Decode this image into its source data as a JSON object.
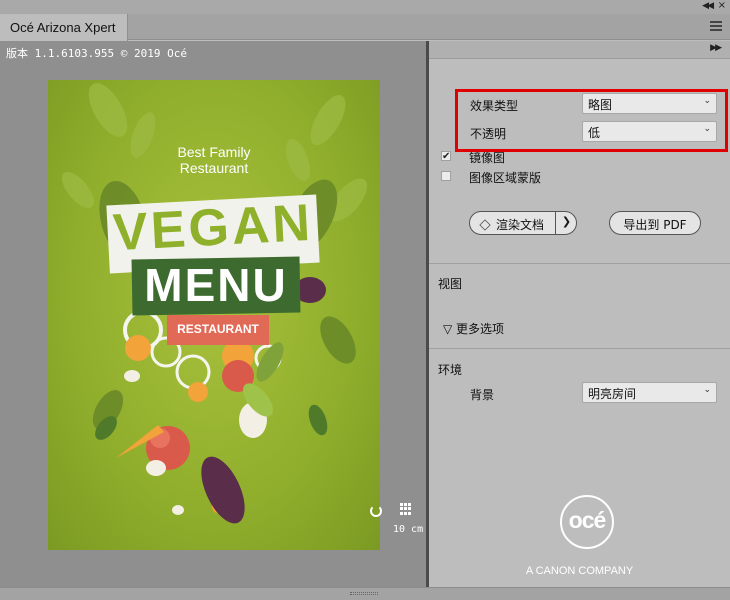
{
  "window": {
    "tab_title": "Océ Arizona Xpert"
  },
  "preview": {
    "version_text": "版本 1.1.6103.955 © 2019 Océ",
    "poster": {
      "line1": "Best Family",
      "line2": "Restaurant",
      "title1": "VEGAN",
      "title2": "MENU",
      "subtitle": "RESTAURANT"
    },
    "scale_text": "10 cm"
  },
  "panel": {
    "effect_type_label": "效果类型",
    "effect_type_value": "略图",
    "opacity_label": "不透明",
    "opacity_value": "低",
    "mirror_label": "镜像图",
    "mirror_checked": true,
    "image_mask_label": "图像区域蒙版",
    "image_mask_checked": false,
    "render_button": "渲染文档",
    "export_button": "导出到 PDF",
    "view_section": "视图",
    "more_options": "更多选项",
    "environment_section": "环境",
    "background_label": "背景",
    "background_value": "明亮房间",
    "logo_text": "océ",
    "tagline": "A CANON COMPANY"
  },
  "colors": {
    "highlight": "#e00000",
    "poster_green": "#8fae2c",
    "menu_green": "#3d6b2f",
    "restaurant_red": "#e06a55"
  }
}
